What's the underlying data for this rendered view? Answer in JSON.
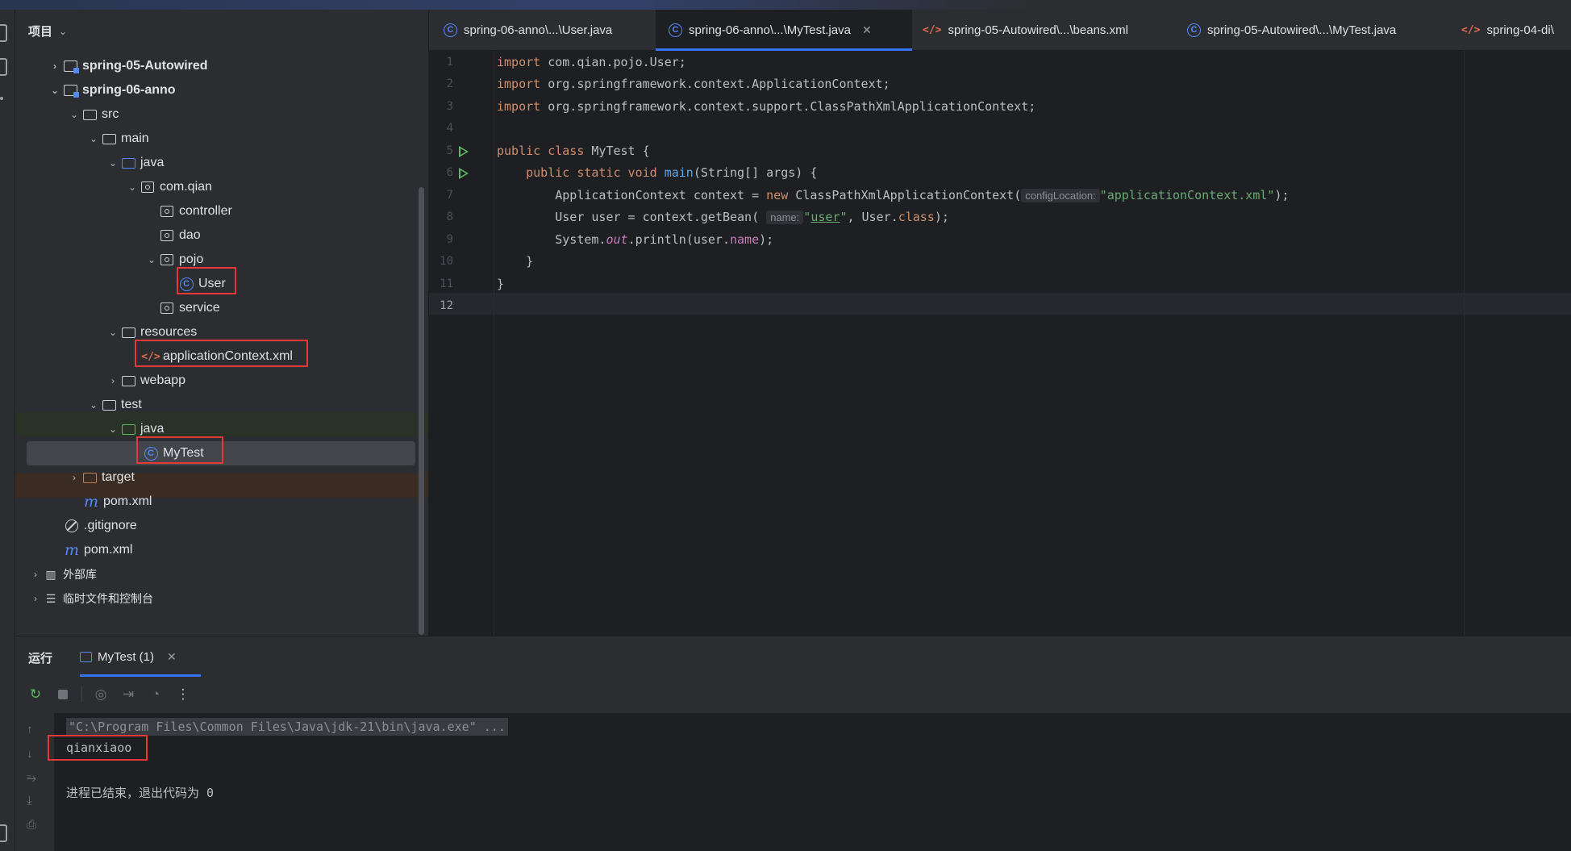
{
  "project_panel": {
    "title": "项目",
    "tree": [
      {
        "label": "spring-05-Autowired",
        "bold": true
      },
      {
        "label": "spring-06-anno",
        "bold": true
      },
      {
        "label": "src"
      },
      {
        "label": "main"
      },
      {
        "label": "java"
      },
      {
        "label": "com.qian"
      },
      {
        "label": "controller"
      },
      {
        "label": "dao"
      },
      {
        "label": "pojo"
      },
      {
        "label": "User"
      },
      {
        "label": "service"
      },
      {
        "label": "resources"
      },
      {
        "label": "applicationContext.xml"
      },
      {
        "label": "webapp"
      },
      {
        "label": "test"
      },
      {
        "label": "java"
      },
      {
        "label": "MyTest"
      },
      {
        "label": "target"
      },
      {
        "label": "pom.xml"
      },
      {
        "label": ".gitignore"
      },
      {
        "label": "pom.xml"
      },
      {
        "label": "外部库"
      },
      {
        "label": "临时文件和控制台"
      }
    ]
  },
  "tabs": [
    {
      "label": "spring-06-anno\\...\\User.java",
      "icon": "class-icon"
    },
    {
      "label": "spring-06-anno\\...\\MyTest.java",
      "icon": "class-icon",
      "active": true
    },
    {
      "label": "spring-05-Autowired\\...\\beans.xml",
      "icon": "xml-icon"
    },
    {
      "label": "spring-05-Autowired\\...\\MyTest.java",
      "icon": "class-icon"
    },
    {
      "label": "spring-04-di\\",
      "icon": "xml-icon"
    }
  ],
  "editor": {
    "line_numbers": [
      "1",
      "2",
      "3",
      "4",
      "5",
      "6",
      "7",
      "8",
      "9",
      "10",
      "11",
      "12"
    ],
    "current_line": 12,
    "hint_config": "configLocation:",
    "hint_name": "name:"
  },
  "run_panel": {
    "title": "运行",
    "tab_label": "MyTest (1)",
    "console": {
      "command": "\"C:\\Program Files\\Common Files\\Java\\jdk-21\\bin\\java.exe\" ...",
      "output": "qianxiaoo",
      "exit_message": "进程已结束，退出代码为 0"
    }
  },
  "colors": {
    "accent": "#3574f0",
    "highlight_box": "#e53935",
    "keyword": "#cf8e6d",
    "string": "#6aab73",
    "function": "#56a8f5"
  }
}
